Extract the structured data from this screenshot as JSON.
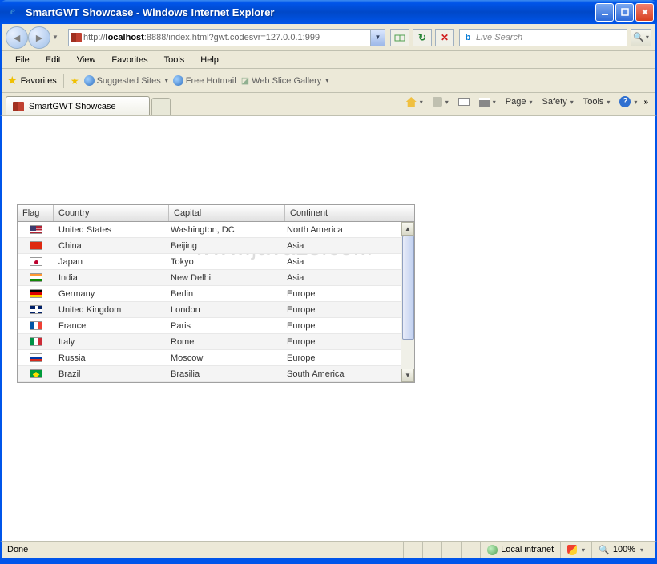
{
  "window": {
    "title": "SmartGWT Showcase - Windows Internet Explorer"
  },
  "nav": {
    "url_prefix": "http://",
    "url_host": "localhost",
    "url_rest": ":8888/index.html?gwt.codesvr=127.0.0.1:999",
    "search_placeholder": "Live Search"
  },
  "menu": [
    "File",
    "Edit",
    "View",
    "Favorites",
    "Tools",
    "Help"
  ],
  "favbar": {
    "favorites": "Favorites",
    "suggested": "Suggested Sites",
    "hotmail": "Free Hotmail",
    "webslice": "Web Slice Gallery"
  },
  "tab": {
    "title": "SmartGWT Showcase"
  },
  "toolbar": {
    "page": "Page",
    "safety": "Safety",
    "tools": "Tools"
  },
  "grid": {
    "headers": {
      "flag": "Flag",
      "country": "Country",
      "capital": "Capital",
      "continent": "Continent"
    },
    "rows": [
      {
        "flag": "flag-us",
        "country": "United States",
        "capital": "Washington, DC",
        "continent": "North America"
      },
      {
        "flag": "flag-cn",
        "country": "China",
        "capital": "Beijing",
        "continent": "Asia"
      },
      {
        "flag": "flag-jp",
        "country": "Japan",
        "capital": "Tokyo",
        "continent": "Asia"
      },
      {
        "flag": "flag-in",
        "country": "India",
        "capital": "New Delhi",
        "continent": "Asia"
      },
      {
        "flag": "flag-de",
        "country": "Germany",
        "capital": "Berlin",
        "continent": "Europe"
      },
      {
        "flag": "flag-gb",
        "country": "United Kingdom",
        "capital": "London",
        "continent": "Europe"
      },
      {
        "flag": "flag-fr",
        "country": "France",
        "capital": "Paris",
        "continent": "Europe"
      },
      {
        "flag": "flag-it",
        "country": "Italy",
        "capital": "Rome",
        "continent": "Europe"
      },
      {
        "flag": "flag-ru",
        "country": "Russia",
        "capital": "Moscow",
        "continent": "Europe"
      },
      {
        "flag": "flag-br",
        "country": "Brazil",
        "capital": "Brasilia",
        "continent": "South America"
      }
    ]
  },
  "status": {
    "done": "Done",
    "zone": "Local intranet",
    "zoom": "100%"
  },
  "watermark": "www.java2s.com"
}
